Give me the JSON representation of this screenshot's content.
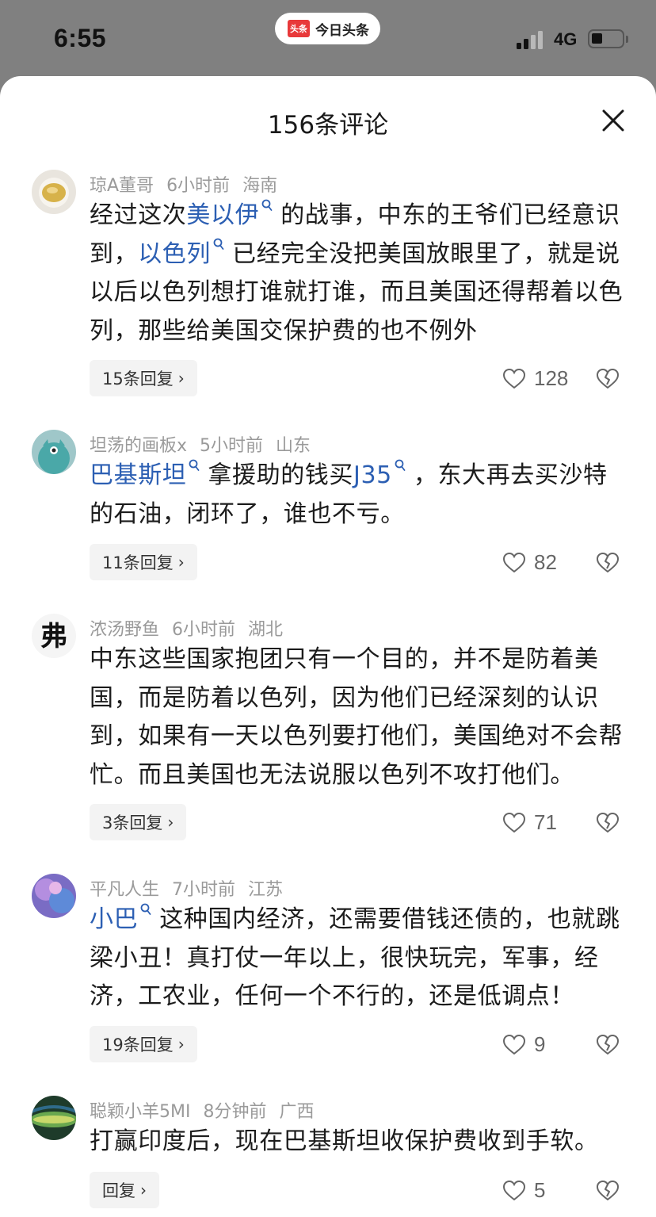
{
  "status_bar": {
    "time": "6:55",
    "app_logo_text": "头条",
    "app_name": "今日头条",
    "network": "4G"
  },
  "sheet": {
    "title": "156条评论"
  },
  "comments": [
    {
      "user": "琼A董哥",
      "time": "6小时前",
      "location": "海南",
      "seg": {
        "t1": "经过这次",
        "l1": "美以伊",
        "t2": "的战事，中东的王爷们已经意识到，",
        "l2": "以色列",
        "t3": "已经完全没把美国放眼里了，就是说以后以色列想打谁就打谁，而且美国还得帮着以色列，那些给美国交保护费的也不例外"
      },
      "replies": "15条回复",
      "likes": "128"
    },
    {
      "user": "坦荡的画板x",
      "time": "5小时前",
      "location": "山东",
      "seg": {
        "l1": "巴基斯坦",
        "t2": "拿援助的钱买",
        "l2": "J35",
        "t3": "，东大再去买沙特的石油，闭环了，谁也不亏。"
      },
      "replies": "11条回复",
      "likes": "82"
    },
    {
      "user": "浓汤野鱼",
      "time": "6小时前",
      "location": "湖北",
      "seg": {
        "t1": "中东这些国家抱团只有一个目的，并不是防着美国，而是防着以色列，因为他们已经深刻的认识到，如果有一天以色列要打他们，美国绝对不会帮忙。而且美国也无法说服以色列不攻打他们。"
      },
      "replies": "3条回复",
      "likes": "71"
    },
    {
      "user": "平凡人生",
      "time": "7小时前",
      "location": "江苏",
      "seg": {
        "l1": "小巴",
        "t2": "这种国内经济，还需要借钱还债的，也就跳梁小丑！真打仗一年以上，很快玩完，军事，经济，工农业，任何一个不行的，还是低调点！"
      },
      "replies": "19条回复",
      "likes": "9"
    },
    {
      "user": "聪颖小羊5MI",
      "time": "8分钟前",
      "location": "广西",
      "seg": {
        "t1": "打赢印度后，现在巴基斯坦收保护费收到手软。"
      },
      "replies": "回复",
      "likes": "5"
    }
  ]
}
